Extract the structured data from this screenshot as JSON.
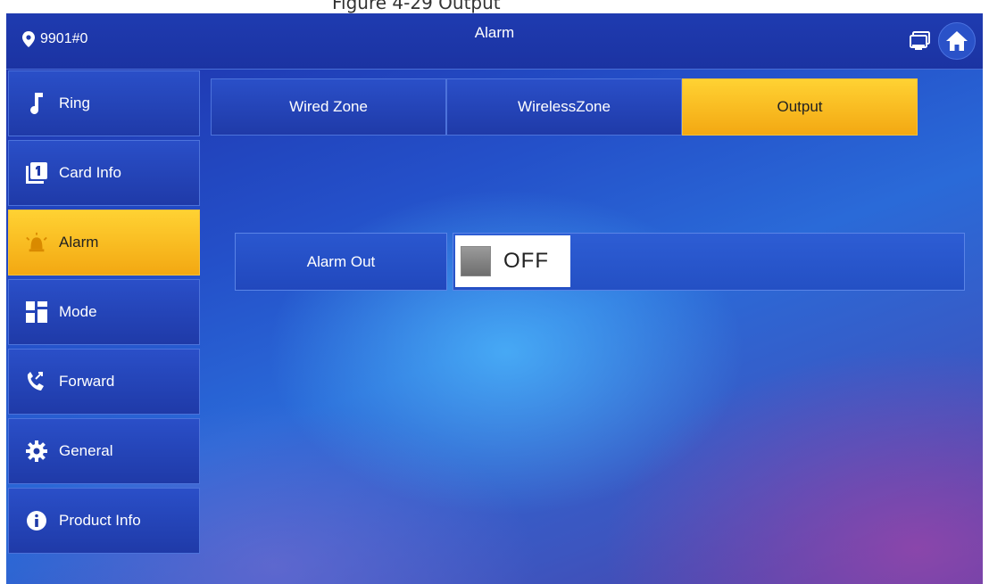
{
  "caption": "Figure 4-29 Output",
  "header": {
    "location": "9901#0",
    "title": "Alarm",
    "icons": [
      "map-pin-icon",
      "monitor-icon",
      "home-icon"
    ]
  },
  "sidebar": {
    "items": [
      {
        "label": "Ring",
        "icon": "music-note-icon",
        "active": false
      },
      {
        "label": "Card Info",
        "icon": "card-icon",
        "active": false
      },
      {
        "label": "Alarm",
        "icon": "alarm-bell-icon",
        "active": true
      },
      {
        "label": "Mode",
        "icon": "mode-grid-icon",
        "active": false
      },
      {
        "label": "Forward",
        "icon": "call-forward-icon",
        "active": false
      },
      {
        "label": "General",
        "icon": "gear-icon",
        "active": false
      },
      {
        "label": "Product Info",
        "icon": "info-icon",
        "active": false
      }
    ]
  },
  "tabs": [
    {
      "label": "Wired Zone",
      "active": false
    },
    {
      "label": "WirelessZone",
      "active": false
    },
    {
      "label": "Output",
      "active": true
    }
  ],
  "settings": {
    "alarm_out": {
      "label": "Alarm Out",
      "state": "OFF"
    }
  },
  "colors": {
    "accent_active": "#f5b71c",
    "panel_blue": "#1f3aa8"
  }
}
